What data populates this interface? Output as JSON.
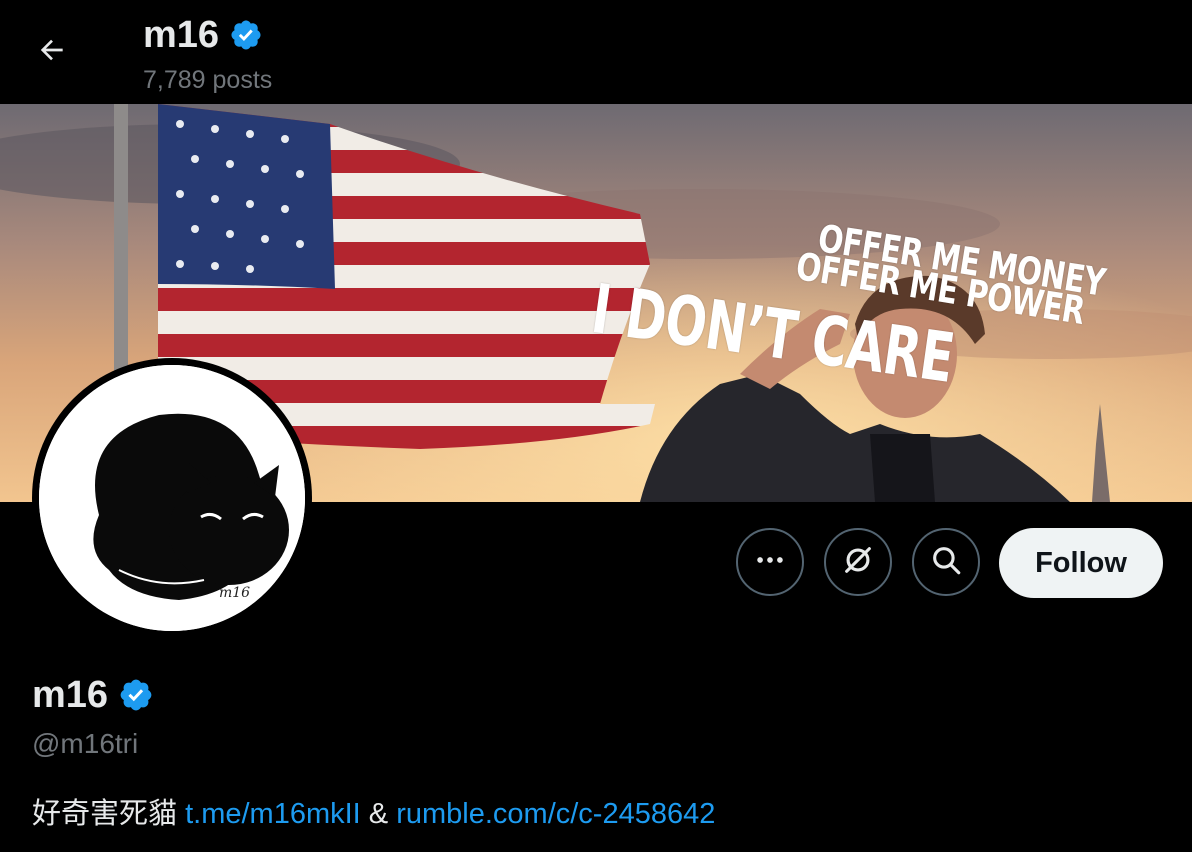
{
  "header": {
    "display_name": "m16",
    "posts_count": "7,789 posts"
  },
  "banner": {
    "line1": "OFFER ME MONEY",
    "line2": "OFFER ME POWER",
    "line3": "I DON’T CARE"
  },
  "actions": {
    "more_icon": "more-horizontal-icon",
    "grok_icon": "grok-icon",
    "search_icon": "search-icon",
    "follow_label": "Follow"
  },
  "profile": {
    "display_name": "m16",
    "handle": "@m16tri",
    "bio_text": "好奇害死貓",
    "bio_link1": "t.me/m16mkII",
    "bio_separator": "&",
    "bio_link2": "rumble.com/c/c-2458642"
  },
  "colors": {
    "background": "#000000",
    "primary_text": "#e7e9ea",
    "secondary_text": "#71767b",
    "link": "#1d9bf0",
    "verified": "#1d9bf0",
    "follow_bg": "#eff3f4"
  }
}
